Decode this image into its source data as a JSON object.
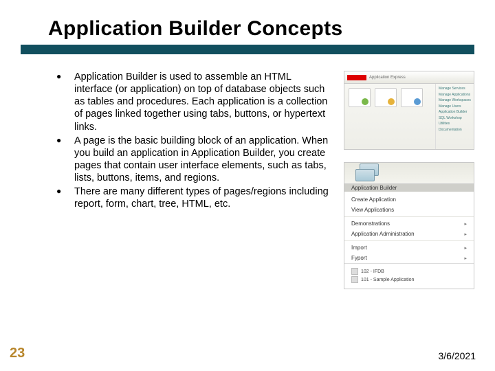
{
  "title": "Application Builder Concepts",
  "bullets": [
    "Application Builder is used to assemble an HTML interface (or application) on top of database objects such as tables and procedures. Each application is a collection of pages linked together using tabs, buttons, or hypertext links.",
    "A page is the basic building block of an application. When you build an application in Application Builder, you create pages that contain user interface elements, such as tabs, lists, buttons, items, and regions.",
    "There are many different types of pages/regions including report, form, chart, tree, HTML, etc."
  ],
  "image1": {
    "header_text": "Application Express",
    "sidebar_items": [
      "Manage Services",
      "Manage Applications",
      "Manage Workspaces",
      "Manage Users",
      "Application Builder",
      "SQL Workshop",
      "Utilities",
      "Documentation"
    ]
  },
  "image2": {
    "label": "Application Builder",
    "menu": [
      {
        "text": "Create Application",
        "arrow": false
      },
      {
        "text": "View Applications",
        "arrow": false
      },
      {
        "text": "Demonstrations",
        "arrow": true
      },
      {
        "text": "Application Administration",
        "arrow": true
      },
      {
        "text": "Import",
        "arrow": true
      },
      {
        "text": "Fyport",
        "arrow": true
      }
    ],
    "bottom": [
      "102 - IFDB",
      "101 - Sample Application"
    ]
  },
  "footer": {
    "page_number": "23",
    "date": "3/6/2021"
  }
}
